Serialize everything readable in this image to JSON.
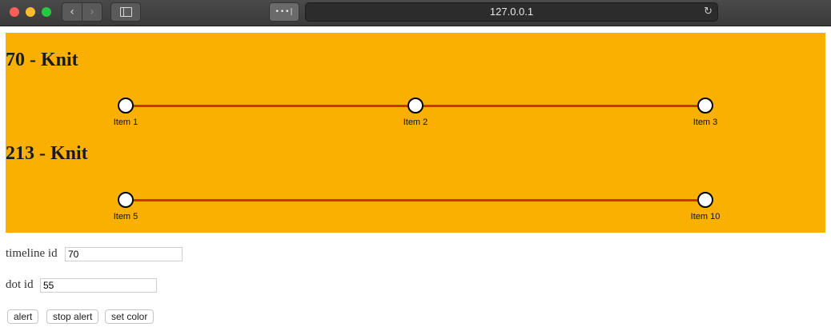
{
  "browser": {
    "url": "127.0.0.1",
    "back_glyph": "‹",
    "forward_glyph": "›",
    "ext_glyph": "•••|",
    "reload_glyph": "↻"
  },
  "timelines": [
    {
      "title": "70 - Knit",
      "dots": [
        {
          "label": "Item 1"
        },
        {
          "label": "Item 2"
        },
        {
          "label": "Item 3"
        }
      ]
    },
    {
      "title": "213 - Knit",
      "dots": [
        {
          "label": "Item 5"
        },
        {
          "label": "Item 10"
        }
      ]
    }
  ],
  "form": {
    "timeline_id_label": "timeline id",
    "timeline_id_value": "70",
    "dot_id_label": "dot id",
    "dot_id_value": "55"
  },
  "buttons": {
    "alert": "alert",
    "stop_alert": "stop alert",
    "set_color": "set color"
  },
  "colors": {
    "panel_bg": "#f9b000",
    "timeline_line": "#cc3300"
  }
}
